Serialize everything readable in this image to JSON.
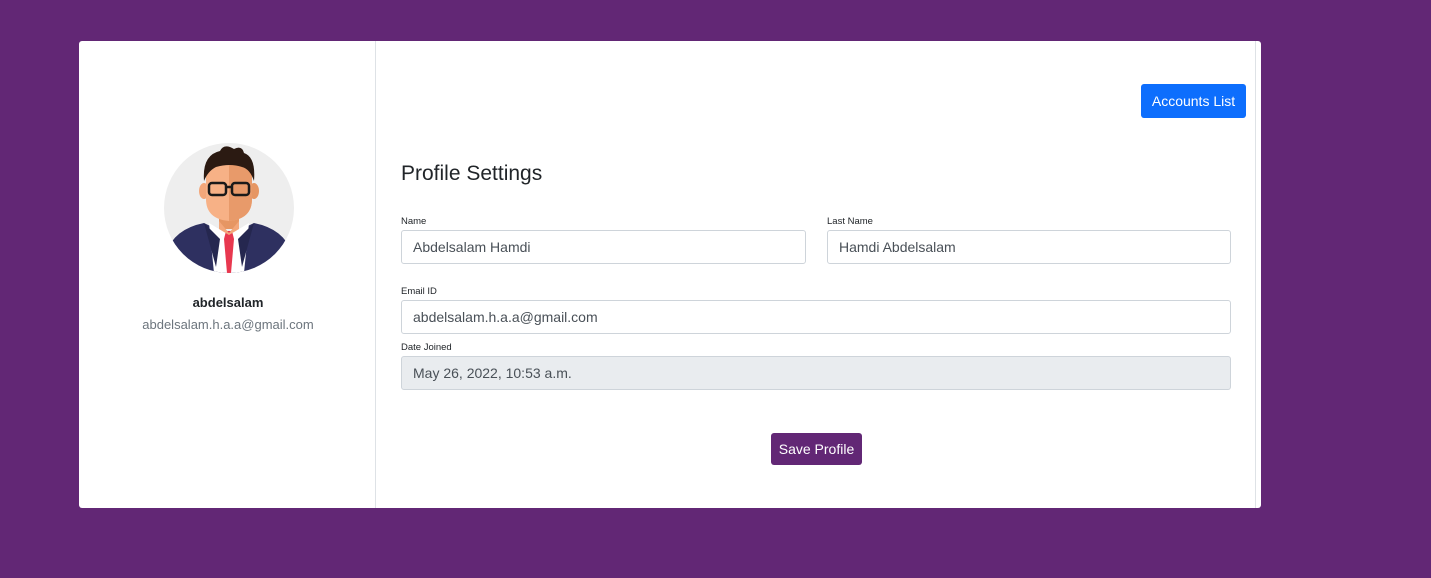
{
  "profile": {
    "username": "abdelsalam",
    "email": "abdelsalam.h.a.a@gmail.com"
  },
  "header": {
    "accounts_button_label": "Accounts List"
  },
  "form": {
    "title": "Profile Settings",
    "name": {
      "label": "Name",
      "value": "Abdelsalam Hamdi"
    },
    "last_name": {
      "label": "Last Name",
      "value": "Hamdi Abdelsalam"
    },
    "email": {
      "label": "Email ID",
      "value": "abdelsalam.h.a.a@gmail.com"
    },
    "date_joined": {
      "label": "Date Joined",
      "value": "May 26, 2022, 10:53 a.m."
    },
    "save_button_label": "Save Profile"
  },
  "colors": {
    "page_background": "#622775",
    "accounts_button": "#0d6efd",
    "save_button": "#622775"
  }
}
